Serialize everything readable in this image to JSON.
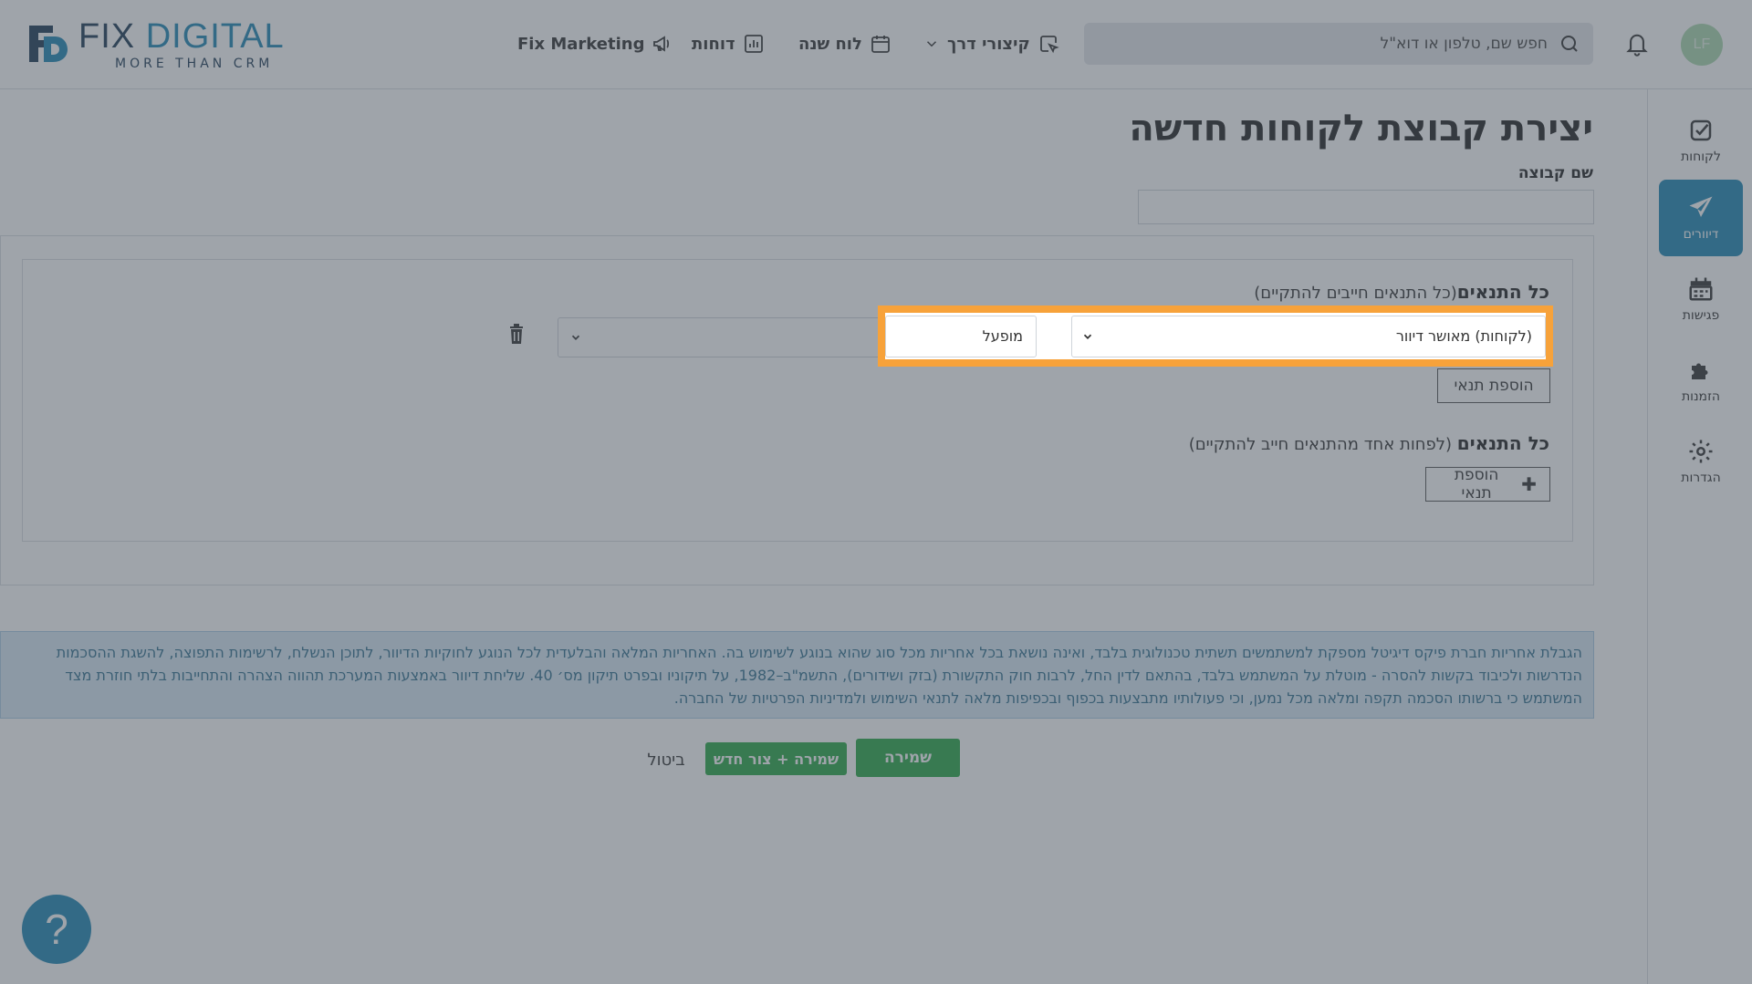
{
  "brand": {
    "name_part1": "FIX",
    "name_part2": "DIGITAL",
    "tagline": "MORE THAN CRM",
    "colors": {
      "navy": "#1d3a55",
      "blue": "#1f86b3"
    }
  },
  "topnav": {
    "marketing": "Fix Marketing",
    "reports": "דוחות",
    "year_board": "לוח שנה",
    "shortcuts": "קיצורי דרך"
  },
  "search": {
    "placeholder": "חפש שם, טלפון או דוא\"ל"
  },
  "user": {
    "initials": "LF"
  },
  "sidebar": {
    "items": [
      {
        "label": "לקוחות",
        "icon": "checkbox-icon"
      },
      {
        "label": "דיוורים",
        "icon": "paper-plane-icon",
        "active": true
      },
      {
        "label": "פגישות",
        "icon": "calendar-icon"
      },
      {
        "label": "הזמנות",
        "icon": "puzzle-icon"
      },
      {
        "label": "הגדרות",
        "icon": "gear-icon"
      }
    ]
  },
  "form": {
    "title": "יצירת קבוצת לקוחות חדשה",
    "group_name_label": "שם קבוצה",
    "group_name_value": "",
    "all_conditions": {
      "title": "כל התנאים",
      "hint": "(כל התנאים חייבים להתקיים)",
      "field_value": "(לקוחות) מאושר דיוור",
      "value": "מופעל",
      "add_label": "הוספת תנאי"
    },
    "any_conditions": {
      "title": "כל התנאים",
      "hint": " (לפחות אחד מהתנאים חייב להתקיים)",
      "add_label": "הוספת תנאי"
    }
  },
  "disclaimer": "הגבלת אחריות חברת פיקס דיגיטל מספקת למשתמשים תשתית טכנולוגית בלבד, ואינה נושאת בכל אחריות מכל סוג שהוא בנוגע לשימוש בה. האחריות המלאה והבלעדית לכל הנוגע לחוקיות הדיוור, לתוכן הנשלח, לרשימות התפוצה, להשגת ההסכמות הנדרשות ולכיבוד בקשות להסרה - מוטלת על המשתמש בלבד, בהתאם לדין החל, לרבות חוק התקשורת (בזק ושידורים), התשמ\"ב–1982, על תיקוניו ובפרט תיקון מס׳ 40. שליחת דיוור באמצעות המערכת תהווה הצהרה והתחייבות בלתי חוזרת מצד המשתמש כי ברשותו הסכמה תקפה ומלאה מכל נמען, וכי פעולותיו מתבצעות בכפוף ובכפיפות מלאה לתנאי השימוש ולמדיניות הפרטיות של החברה.",
  "actions": {
    "save": "שמירה",
    "save_new": "שמירה + צור חדש",
    "cancel": "ביטול"
  },
  "help": {
    "label": "?"
  },
  "highlight_color": "#f7a23a"
}
